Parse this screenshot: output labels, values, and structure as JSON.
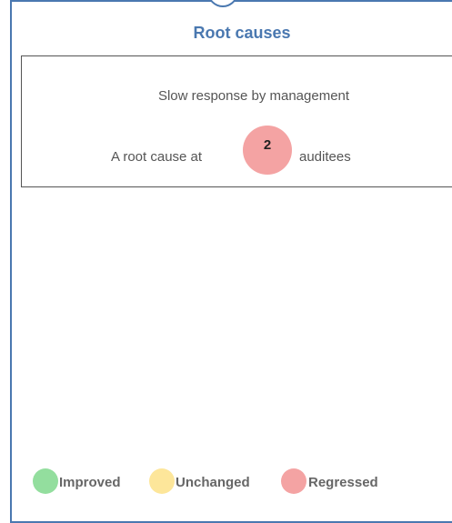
{
  "panel": {
    "title": "Root causes"
  },
  "cause": {
    "name": "Slow response by management",
    "prefix": "A root cause  at",
    "count": "2",
    "suffix": "auditees"
  },
  "legend": [
    {
      "label": "Improved",
      "color": "#93de9e"
    },
    {
      "label": "Unchanged",
      "color": "#fde69a"
    },
    {
      "label": "Regressed",
      "color": "#f4a3a3"
    }
  ],
  "colors": {
    "frame_border": "#4a78b0",
    "title": "#4a78b0",
    "badge": "#f4a3a3"
  }
}
